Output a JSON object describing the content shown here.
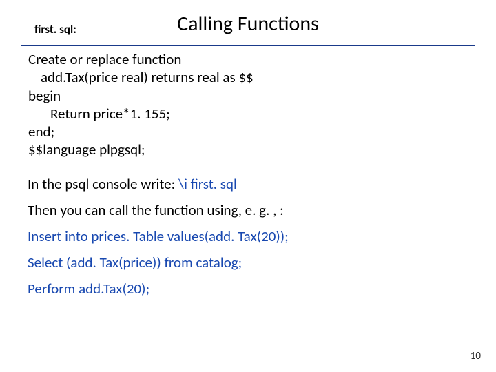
{
  "header": {
    "file_label": "first. sql:",
    "title": "Calling Functions"
  },
  "code": {
    "l1": "Create or replace function",
    "l2": "add.Tax(price real) returns real as $$",
    "l3": "begin",
    "l4": "Return  price*1. 155;",
    "l5": "end;",
    "l6": "$$language plpgsql;"
  },
  "body": {
    "p1a": "In the psql console write: ",
    "p1b": "\\i first. sql",
    "p2": "Then you can call the function using, e. g. , :",
    "p3": "Insert into prices. Table values(add. Tax(20));",
    "p4": "Select (add. Tax(price)) from catalog;",
    "p5": "Perform  add.Tax(20);"
  },
  "page_number": "10"
}
